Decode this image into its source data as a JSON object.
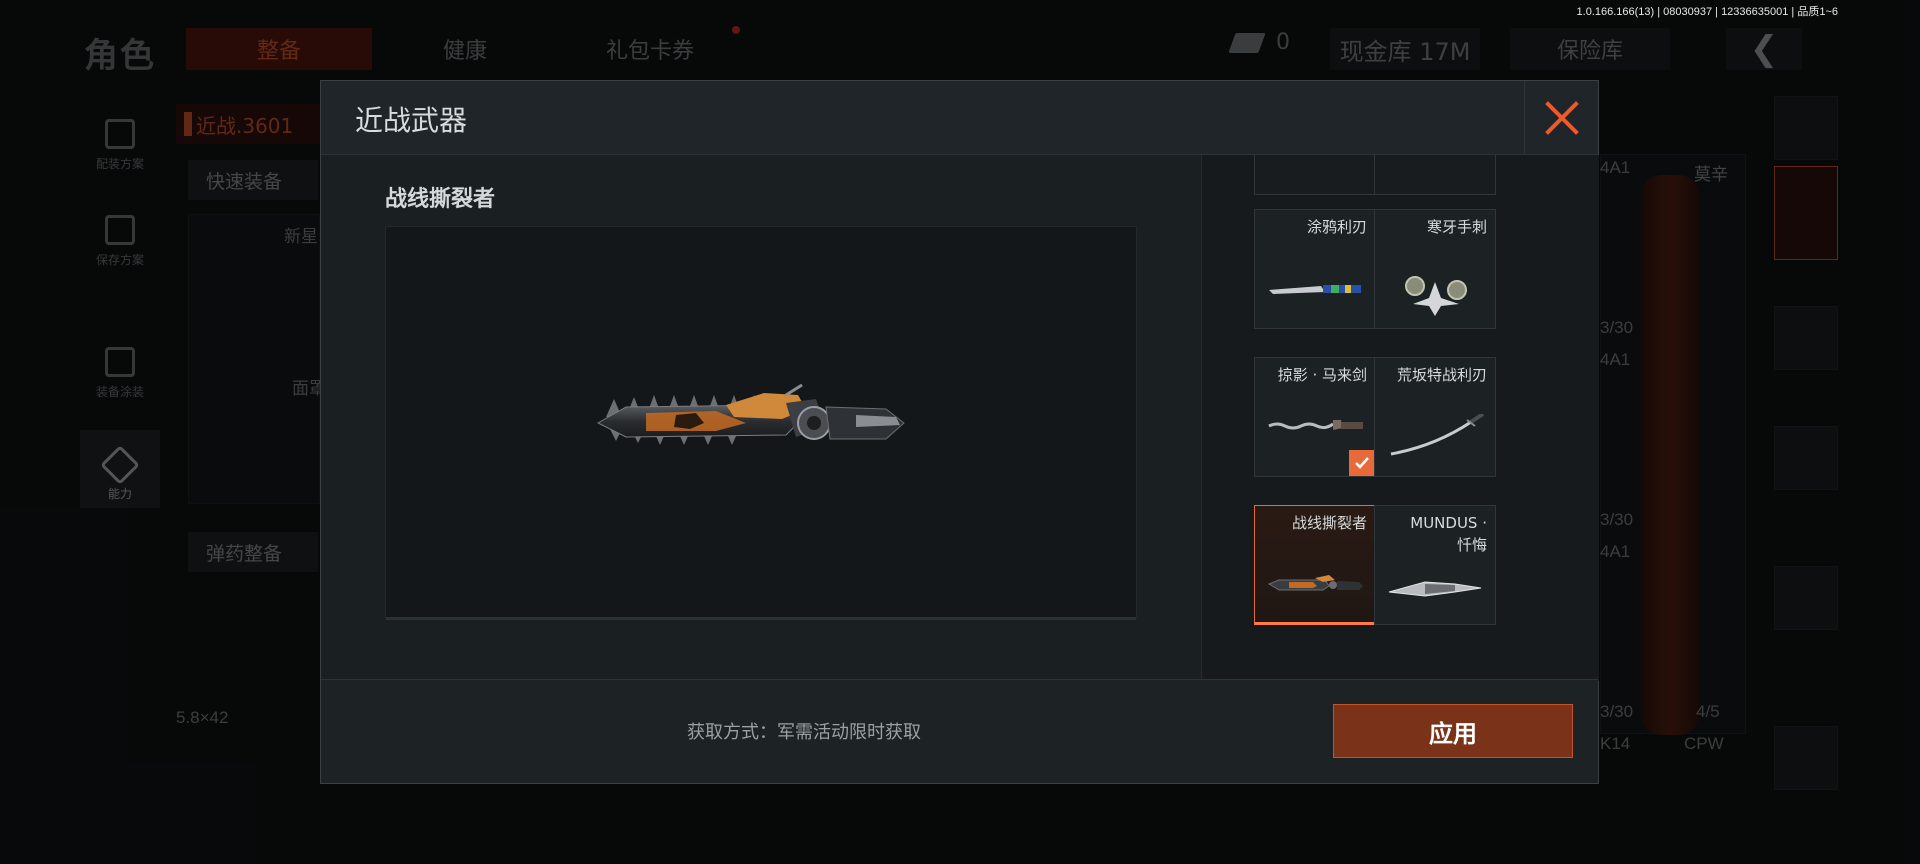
{
  "build_info": "1.0.166.166(13) | 08030937 | 12336635001 | 品质1~6",
  "background": {
    "title": "角色",
    "tabs": [
      {
        "label": "整备",
        "active": true
      },
      {
        "label": "健康",
        "active": false
      },
      {
        "label": "礼包卡券",
        "active": false
      }
    ],
    "ticket_count": "0",
    "cash_vault": "现金库 17M",
    "insurance_vault": "保险库",
    "side_nav": [
      {
        "label": "配装方案",
        "icon": "vest-icon"
      },
      {
        "label": "保存方案",
        "icon": "download-icon"
      },
      {
        "label": "装备涂装",
        "icon": "helmet-icon"
      },
      {
        "label": "能力",
        "icon": "ability-icon",
        "active": true
      }
    ],
    "loadout_name": "近战.3601",
    "quick_equip": "快速装备",
    "ammo_equip": "弹药整备",
    "helmet_label": "新星",
    "face_label": "面罩",
    "caliber": "5.8×42",
    "right_labels": {
      "rifle_name": "莫辛",
      "a1": "4A1",
      "ammo1": "3/30",
      "a2": "4A1",
      "ammo2": "3/30",
      "a3": "4A1",
      "ammo3": "3/30",
      "fraction": "4/5",
      "k14": "K14",
      "cpw": "CPW"
    }
  },
  "modal": {
    "title": "近战武器",
    "selected_weapon": "战线撕裂者",
    "items": [
      {
        "name": "涂鸦利刃",
        "selected": false,
        "equipped": false,
        "art": "graffiti-blade"
      },
      {
        "name": "寒牙手刺",
        "selected": false,
        "equipped": false,
        "art": "fang-claws"
      },
      {
        "name": "掠影 · 马来剑",
        "selected": false,
        "equipped": true,
        "art": "kris"
      },
      {
        "name": "荒坂特战利刃",
        "selected": false,
        "equipped": false,
        "art": "katana"
      },
      {
        "name": "战线撕裂者",
        "selected": true,
        "equipped": false,
        "art": "chainsaw-blade"
      },
      {
        "name": "MUNDUS ·",
        "name2": "忏悔",
        "selected": false,
        "equipped": false,
        "art": "mundus-knife"
      }
    ],
    "acquire_text": "获取方式：军需活动限时获取",
    "apply_label": "应用"
  }
}
